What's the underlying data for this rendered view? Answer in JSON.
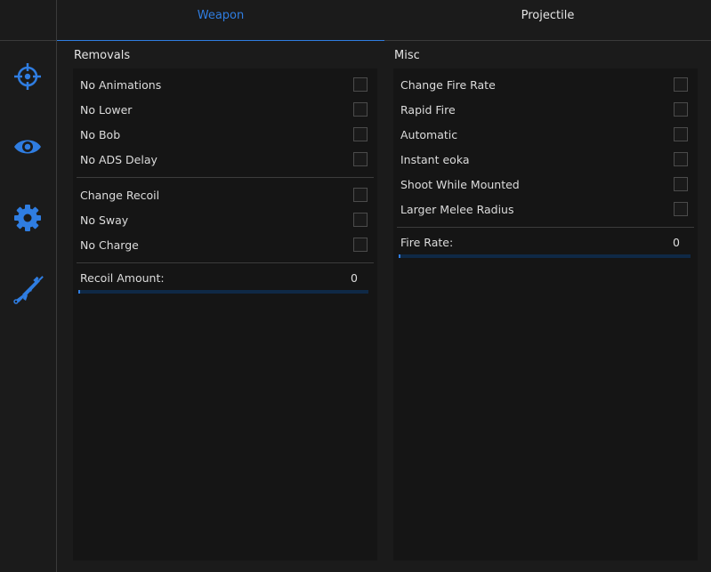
{
  "tabs": [
    {
      "label": "Weapon",
      "active": true
    },
    {
      "label": "Projectile",
      "active": false
    }
  ],
  "sidebar": {
    "icons": [
      "crosshair-icon",
      "eye-icon",
      "gear-icon",
      "rifle-icon"
    ],
    "accent_color": "#2f7de1"
  },
  "removals": {
    "title": "Removals",
    "group1": [
      {
        "label": "No Animations",
        "checked": false
      },
      {
        "label": "No Lower",
        "checked": false
      },
      {
        "label": "No Bob",
        "checked": false
      },
      {
        "label": "No ADS Delay",
        "checked": false
      }
    ],
    "group2": [
      {
        "label": "Change Recoil",
        "checked": false
      },
      {
        "label": "No Sway",
        "checked": false
      },
      {
        "label": "No Charge",
        "checked": false
      }
    ],
    "slider": {
      "label": "Recoil Amount:",
      "value": "0"
    }
  },
  "misc": {
    "title": "Misc",
    "items": [
      {
        "label": "Change Fire Rate",
        "checked": false
      },
      {
        "label": "Rapid Fire",
        "checked": false
      },
      {
        "label": "Automatic",
        "checked": false
      },
      {
        "label": "Instant eoka",
        "checked": false
      },
      {
        "label": "Shoot While Mounted",
        "checked": false
      },
      {
        "label": "Larger Melee Radius",
        "checked": false
      }
    ],
    "slider": {
      "label": "Fire Rate:",
      "value": "0"
    }
  }
}
